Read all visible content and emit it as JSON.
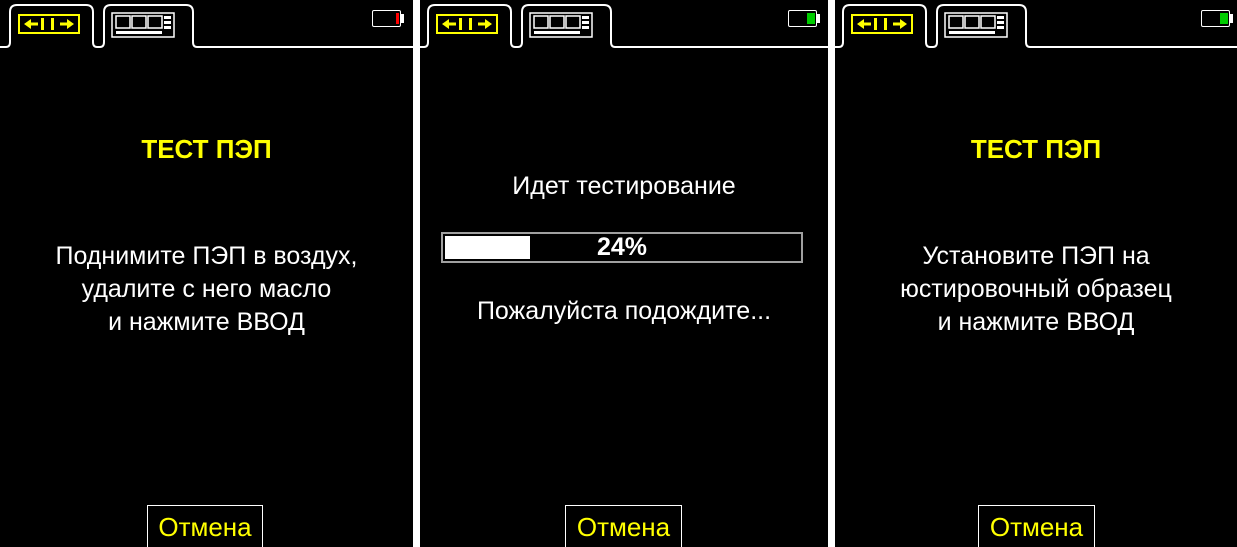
{
  "colors": {
    "background": "#000000",
    "title": "#ffff00",
    "text": "#ffffff",
    "accent": "#ffff00",
    "battery_low": "#ff0000",
    "battery_ok": "#00cc00"
  },
  "tabs": {
    "tab1_icon": "probe-arrows-icon",
    "tab2_icon": "digital-display-icon"
  },
  "progress_value": 24,
  "screens": [
    {
      "battery_level": 0.1,
      "battery_color": "#ff0000",
      "title": "ТЕСТ ПЭП",
      "message_lines": [
        "Поднимите ПЭП в воздух,",
        "удалите с него масло",
        "и нажмите ВВОД"
      ],
      "cancel_label": "Отмена"
    },
    {
      "battery_level": 0.3,
      "battery_color": "#00cc00",
      "status_text": "Идет тестирование",
      "progress_label": "24%",
      "wait_text": "Пожалуйста подождите...",
      "cancel_label": "Отмена"
    },
    {
      "battery_level": 0.3,
      "battery_color": "#00cc00",
      "title": "ТЕСТ ПЭП",
      "message_lines": [
        "Установите ПЭП на",
        "юстировочный образец",
        "и нажмите ВВОД"
      ],
      "cancel_label": "Отмена"
    }
  ]
}
